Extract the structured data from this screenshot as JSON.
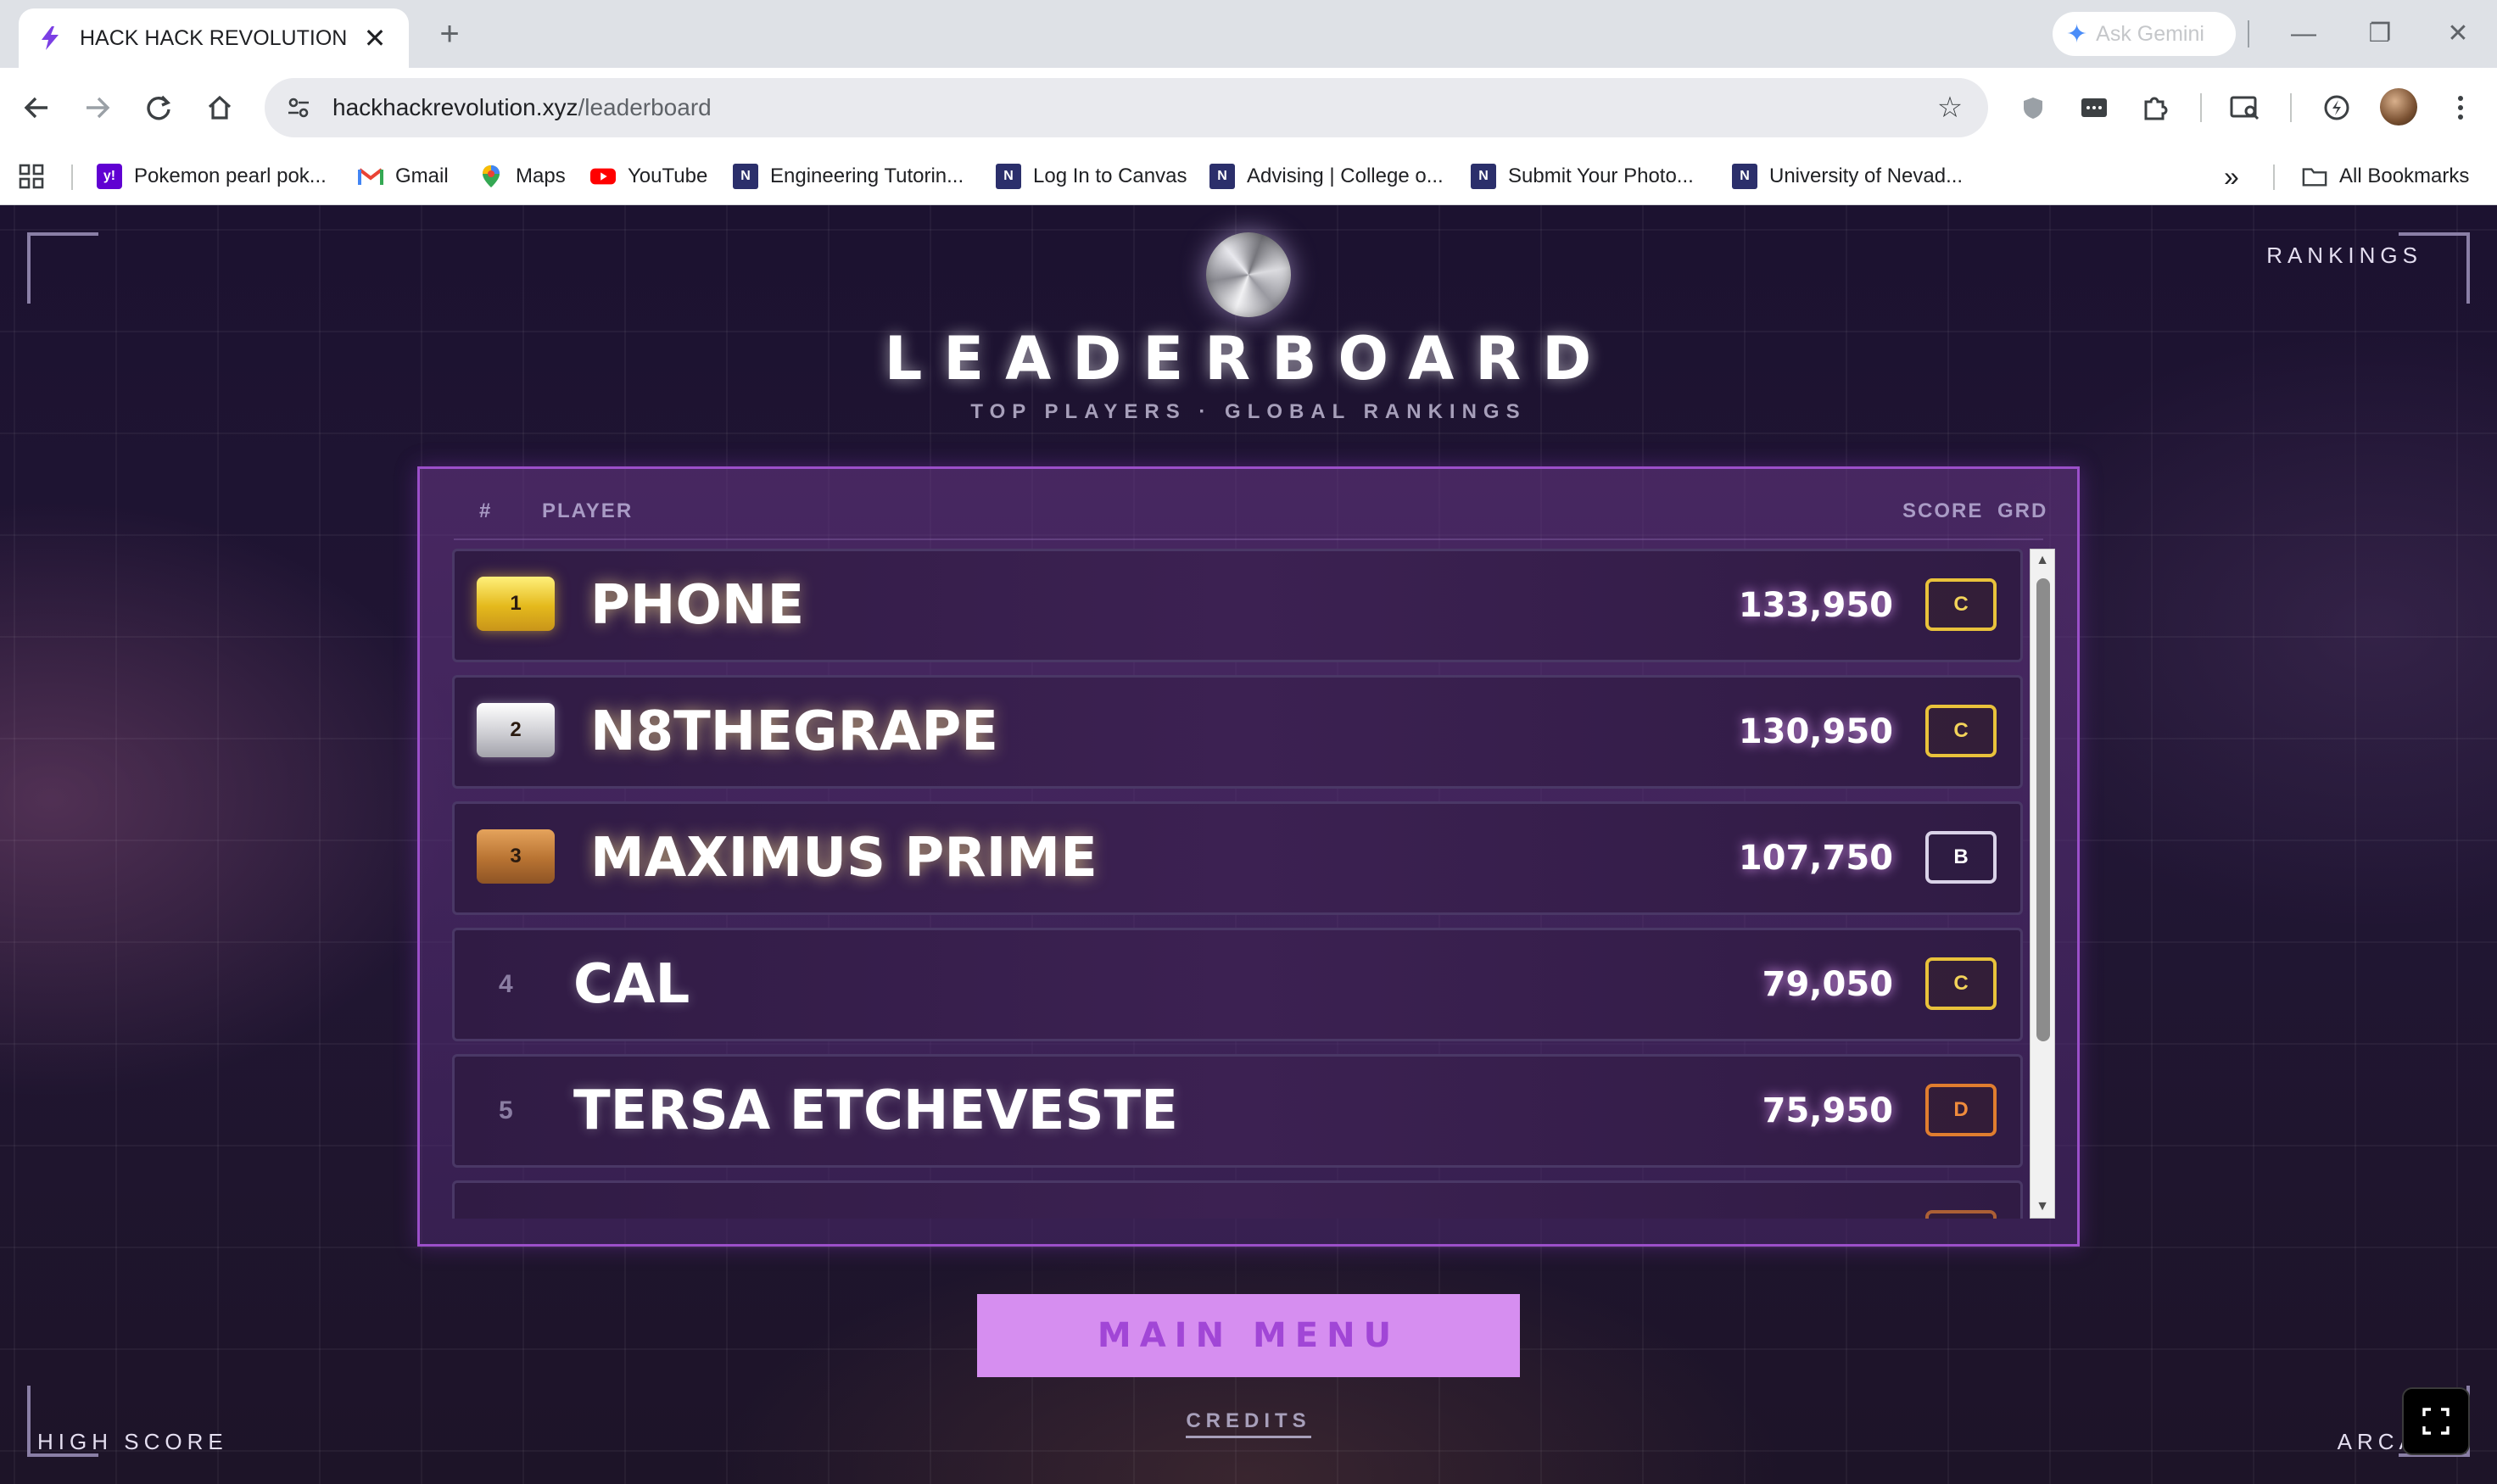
{
  "browser": {
    "tab": {
      "title": "HACK HACK REVOLUTION",
      "favicon": "lightning-icon",
      "close_glyph": "✕"
    },
    "new_tab_glyph": "+",
    "gemini": {
      "label": "Ask Gemini",
      "icon": "gemini-sparkle-icon"
    },
    "window_controls": {
      "minimize": "—",
      "restore": "❐",
      "close": "✕"
    },
    "address": {
      "domain": "hackhackrevolution.xyz",
      "path": "/leaderboard"
    },
    "bookmarks": [
      {
        "label": "Pokemon pearl pok...",
        "icon": "yahoo-icon"
      },
      {
        "label": "Gmail",
        "icon": "gmail-icon"
      },
      {
        "label": "Maps",
        "icon": "maps-icon"
      },
      {
        "label": "YouTube",
        "icon": "youtube-icon"
      },
      {
        "label": "Engineering Tutorin...",
        "icon": "unr-n-icon"
      },
      {
        "label": "Log In to Canvas",
        "icon": "unr-n-icon"
      },
      {
        "label": "Advising | College o...",
        "icon": "unr-n-icon"
      },
      {
        "label": "Submit Your Photo...",
        "icon": "unr-n-icon"
      },
      {
        "label": "University of Nevad...",
        "icon": "unr-n-icon"
      }
    ],
    "more_bookmarks_glyph": "»",
    "all_bookmarks": "All Bookmarks"
  },
  "page": {
    "corners": {
      "top_right": "RANKINGS",
      "bottom_left": "HIGH SCORE",
      "bottom_right": "ARCADE"
    },
    "title": "LEADERBOARD",
    "subtitle": "TOP PLAYERS · GLOBAL RANKINGS",
    "columns": {
      "rank": "#",
      "player": "PLAYER",
      "score": "SCORE",
      "grade": "GRD"
    },
    "rows": [
      {
        "rank": "1",
        "name": "PHONE",
        "score": "133,950",
        "grade": "C"
      },
      {
        "rank": "2",
        "name": "N8THEGRAPE",
        "score": "130,950",
        "grade": "C"
      },
      {
        "rank": "3",
        "name": "MAXIMUS PRIME",
        "score": "107,750",
        "grade": "B"
      },
      {
        "rank": "4",
        "name": "CAL",
        "score": "79,050",
        "grade": "C"
      },
      {
        "rank": "5",
        "name": "TERSA ETCHEVESTE",
        "score": "75,950",
        "grade": "D"
      }
    ],
    "main_menu": "MAIN MENU",
    "credits": "CREDITS"
  },
  "colors": {
    "panel_border": "#9b4fc9",
    "gold": "#e4b91c",
    "silver": "#cfcfd4",
    "bronze": "#b87332",
    "grade_c": "#e9c23b",
    "grade_b": "#d9d2e8",
    "grade_d": "#e07d2f",
    "menu_button": "#d68ef0"
  }
}
